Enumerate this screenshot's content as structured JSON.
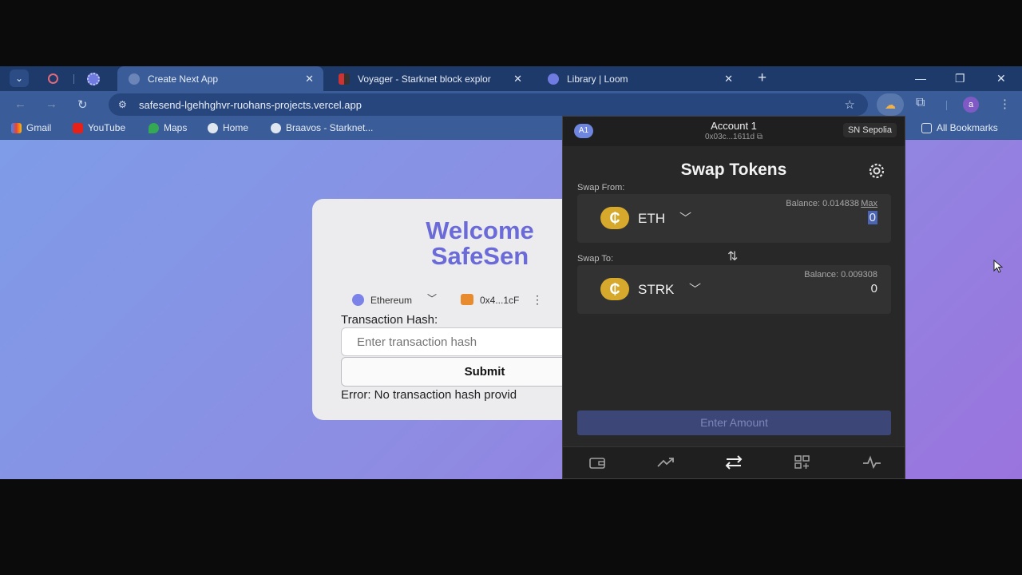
{
  "tabs": [
    {
      "label": "Create Next App",
      "active": true
    },
    {
      "label": "Voyager - Starknet block explor",
      "active": false
    },
    {
      "label": "Library | Loom",
      "active": false
    }
  ],
  "tab_close_glyph": "✕",
  "new_tab_glyph": "+",
  "window_controls": {
    "minimize": "—",
    "restore": "❐",
    "close": "✕"
  },
  "address_bar": {
    "url": "safesend-lgehhghvr-ruohans-projects.vercel.app"
  },
  "profile_initial": "a",
  "bookmarks": [
    "Gmail",
    "YouTube",
    "Maps",
    "Home",
    "Braavos - Starknet..."
  ],
  "all_bookmarks": "All Bookmarks",
  "page": {
    "welcome_line1": "Welcome",
    "welcome_line2": "SafeSen",
    "chain": "Ethereum",
    "wallet_address": "0x4...1cF",
    "hash_label": "Transaction Hash:",
    "hash_placeholder": "Enter transaction hash",
    "submit_label": "Submit",
    "error_text": "Error: No transaction hash provid"
  },
  "wallet": {
    "account_badge": "A1",
    "account_name": "Account 1",
    "account_address": "0x03c...1611d",
    "network": "SN Sepolia",
    "title": "Swap Tokens",
    "swap_from_label": "Swap From:",
    "swap_to_label": "Swap To:",
    "from_token": {
      "symbol": "ETH",
      "balance": "Balance: 0.014838",
      "max": "Max",
      "amount": "0"
    },
    "to_token": {
      "symbol": "STRK",
      "balance": "Balance: 0.009308",
      "amount": "0"
    },
    "token_glyph": "₵",
    "chevron_glyph": "﹀",
    "swap_arrows_glyph": "⇅",
    "enter_amount_label": "Enter Amount"
  },
  "colors": {
    "accent": "#6a6ad8",
    "wallet_bg": "#282828",
    "token_coin": "#d6a92c"
  }
}
